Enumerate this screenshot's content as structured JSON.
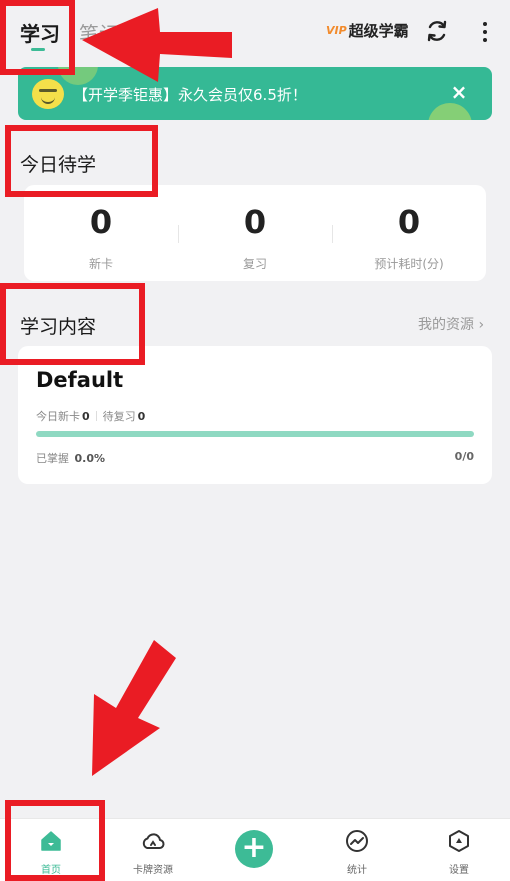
{
  "header": {
    "tab_study": "学习",
    "tab_notes": "笔记",
    "vip_badge": "VIP",
    "vip_label": "超级学霸"
  },
  "banner": {
    "text": "【开学季钜惠】永久会员仅6.5折！",
    "close": "×"
  },
  "today": {
    "title": "今日待学",
    "stats": [
      {
        "value": "0",
        "label": "新卡"
      },
      {
        "value": "0",
        "label": "复习"
      },
      {
        "value": "0",
        "label": "预计耗时(分)"
      }
    ]
  },
  "content": {
    "title": "学习内容",
    "my_resources": "我的资源 ›",
    "deck": {
      "name": "Default",
      "new_today_label": "今日新卡",
      "new_today": "0",
      "to_review_label": "待复习",
      "to_review": "0",
      "progress": 0,
      "mastered_label": "已掌握",
      "mastered": "0.0%",
      "ratio": "0/0"
    }
  },
  "nav": {
    "items": [
      {
        "label": "首页",
        "icon": "home-icon"
      },
      {
        "label": "卡牌资源",
        "icon": "cloud-icon"
      },
      {
        "label": "+",
        "icon": "add-icon"
      },
      {
        "label": "统计",
        "icon": "stats-icon"
      },
      {
        "label": "设置",
        "icon": "settings-icon"
      }
    ]
  },
  "colors": {
    "accent": "#3dbb96",
    "annotation": "#ea1c24",
    "background": "#f1f1f3"
  }
}
